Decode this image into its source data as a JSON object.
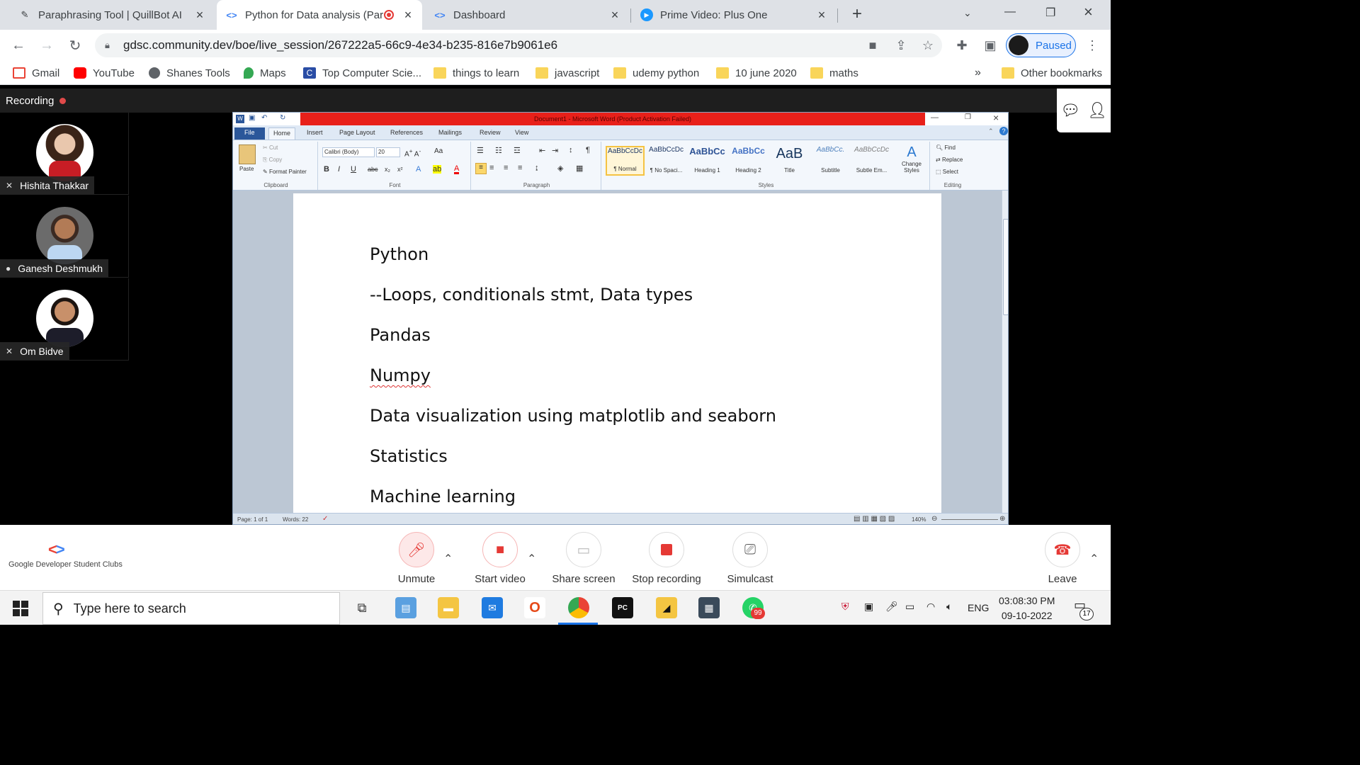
{
  "browser": {
    "tabs": [
      {
        "label": "Paraphrasing Tool | QuillBot AI",
        "icon": "quillbot-icon"
      },
      {
        "label": "Python for Data analysis (Par",
        "icon": "gdsc-icon",
        "recording": true
      },
      {
        "label": "Dashboard",
        "icon": "gdsc-icon"
      },
      {
        "label": "Prime Video: Plus One",
        "icon": "prime-video-icon"
      }
    ],
    "new_tab": "+",
    "url": "gdsc.community.dev/boe/live_session/267222a5-66c9-4e34-b235-816e7b9061e6",
    "profile_status": "Paused",
    "bookmarks": [
      "Gmail",
      "YouTube",
      "Shanes Tools",
      "Maps",
      "Top Computer Scie...",
      "things to learn",
      "javascript",
      "udemy python",
      "10 june 2020",
      "maths"
    ],
    "bookmarks_overflow": "»",
    "other_bookmarks": "Other bookmarks"
  },
  "meeting": {
    "recording_label": "Recording",
    "participants": [
      {
        "name": "Hishita Thakkar",
        "muted": true
      },
      {
        "name": "Ganesh Deshmukh",
        "muted": false
      },
      {
        "name": "Om Bidve",
        "muted": true
      }
    ],
    "controls": {
      "unmute": "Unmute",
      "start_video": "Start video",
      "share_screen": "Share screen",
      "stop_recording": "Stop recording",
      "simulcast": "Simulcast",
      "leave": "Leave"
    },
    "brand": "Google Developer Student Clubs"
  },
  "word": {
    "title": "Document1 - Microsoft Word (Product Activation Failed)",
    "tabs": [
      "File",
      "Home",
      "Insert",
      "Page Layout",
      "References",
      "Mailings",
      "Review",
      "View"
    ],
    "clipboard": {
      "paste": "Paste",
      "cut": "Cut",
      "copy": "Copy",
      "format_painter": "Format Painter",
      "group": "Clipboard"
    },
    "font": {
      "name": "Calibri (Body)",
      "size": "20",
      "group": "Font"
    },
    "paragraph_group": "Paragraph",
    "styles": [
      {
        "preview": "AaBbCcDc",
        "name": "¶ Normal"
      },
      {
        "preview": "AaBbCcDc",
        "name": "¶ No Spaci..."
      },
      {
        "preview": "AaBbCc",
        "name": "Heading 1"
      },
      {
        "preview": "AaBbCc",
        "name": "Heading 2"
      },
      {
        "preview": "AaB",
        "name": "Title"
      },
      {
        "preview": "AaBbCc.",
        "name": "Subtitle"
      },
      {
        "preview": "AaBbCcDc",
        "name": "Subtle Em..."
      }
    ],
    "styles_group": "Styles",
    "change_styles": "Change Styles",
    "editing": {
      "find": "Find",
      "replace": "Replace",
      "select": "Select",
      "group": "Editing"
    },
    "document_lines": [
      "Python",
      "--Loops, conditionals stmt, Data types",
      "Pandas",
      "Numpy",
      "Data visualization using matplotlib and seaborn",
      "Statistics",
      "Machine learning"
    ],
    "status": {
      "page": "Page: 1 of 1",
      "words": "Words: 22",
      "zoom": "140%"
    }
  },
  "taskbar": {
    "search_placeholder": "Type here to search",
    "language": "ENG",
    "time": "03:08:30 PM",
    "date": "09-10-2022",
    "notification_count": "17",
    "whatsapp_badge": "99"
  },
  "colors": {
    "accent": "#1a73e8",
    "record": "#e53935",
    "word_title": "#e8201a"
  }
}
